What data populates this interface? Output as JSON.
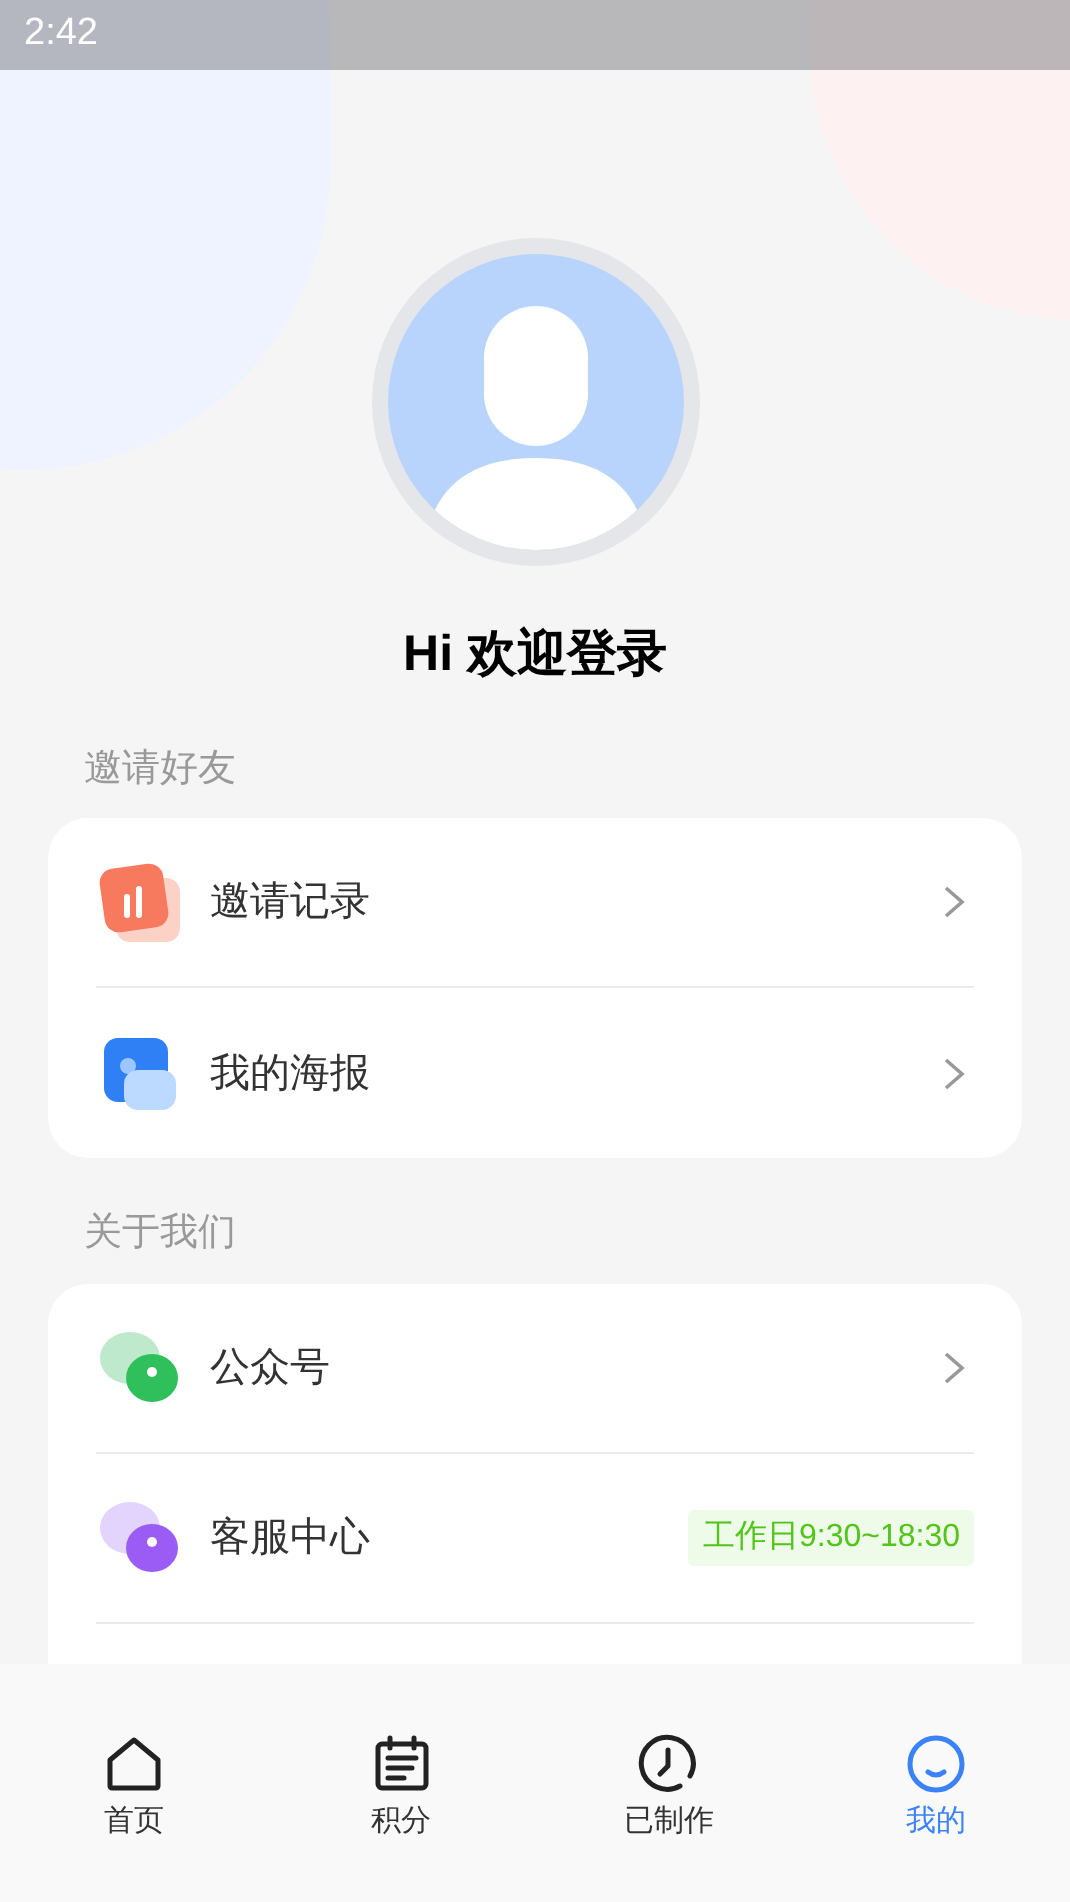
{
  "status_bar": {
    "time": "2:42"
  },
  "greeting": "Hi 欢迎登录",
  "sections": [
    {
      "title": "邀请好友",
      "items": [
        {
          "kind": "chevron",
          "label": "邀请记录"
        },
        {
          "kind": "chevron",
          "label": "我的海报"
        }
      ]
    },
    {
      "title": "关于我们",
      "items": [
        {
          "kind": "chevron",
          "label": "公众号"
        },
        {
          "kind": "badge",
          "label": "客服中心",
          "badge": "工作日9:30~18:30"
        }
      ]
    }
  ],
  "tabs": [
    {
      "label": "首页",
      "selected": false
    },
    {
      "label": "积分",
      "selected": false
    },
    {
      "label": "已制作",
      "selected": false
    },
    {
      "label": "我的",
      "selected": true
    }
  ]
}
